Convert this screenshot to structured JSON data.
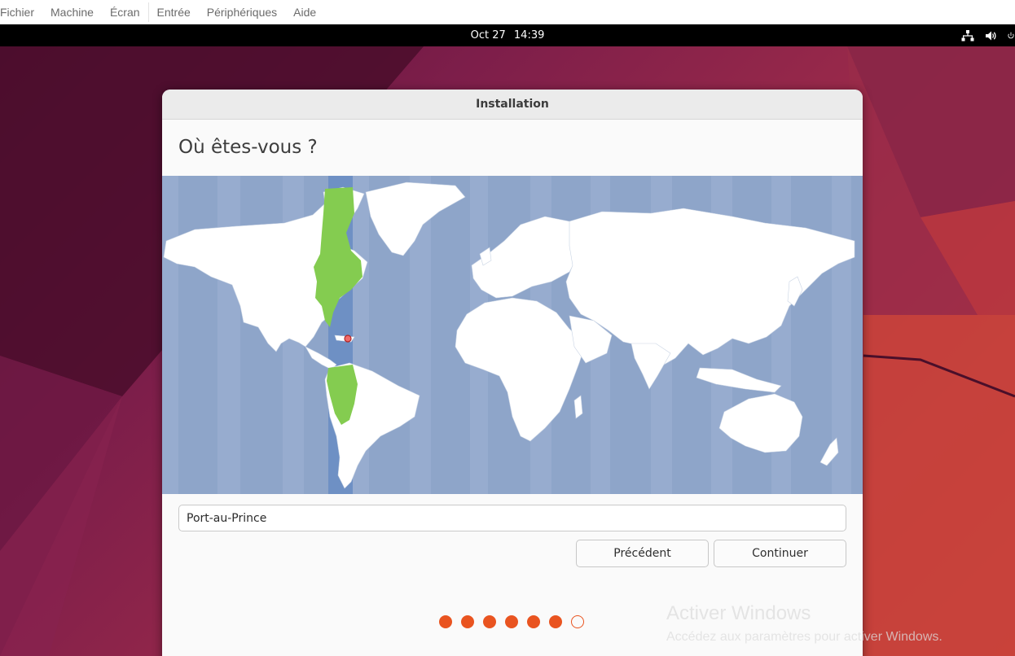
{
  "host_menu": {
    "items": [
      "Fichier",
      "Machine",
      "Écran",
      "Entrée",
      "Périphériques",
      "Aide"
    ]
  },
  "topbar": {
    "date": "Oct 27",
    "time": "14:39",
    "icons": [
      "network-icon",
      "volume-icon",
      "power-icon"
    ]
  },
  "window": {
    "title": "Installation",
    "heading": "Où êtes-vous ?",
    "location_value": "Port-au-Prince",
    "back_label": "Précédent",
    "continue_label": "Continuer",
    "steps_done": 6,
    "steps_total": 7
  },
  "watermark": {
    "title": "Activer Windows",
    "subtitle": "Accédez aux paramètres pour activer Windows."
  },
  "colors": {
    "accent": "#e95420",
    "map_ocean": "#8ea5c9",
    "map_land": "#ffffff",
    "timezone_highlight": "#84cc50"
  }
}
